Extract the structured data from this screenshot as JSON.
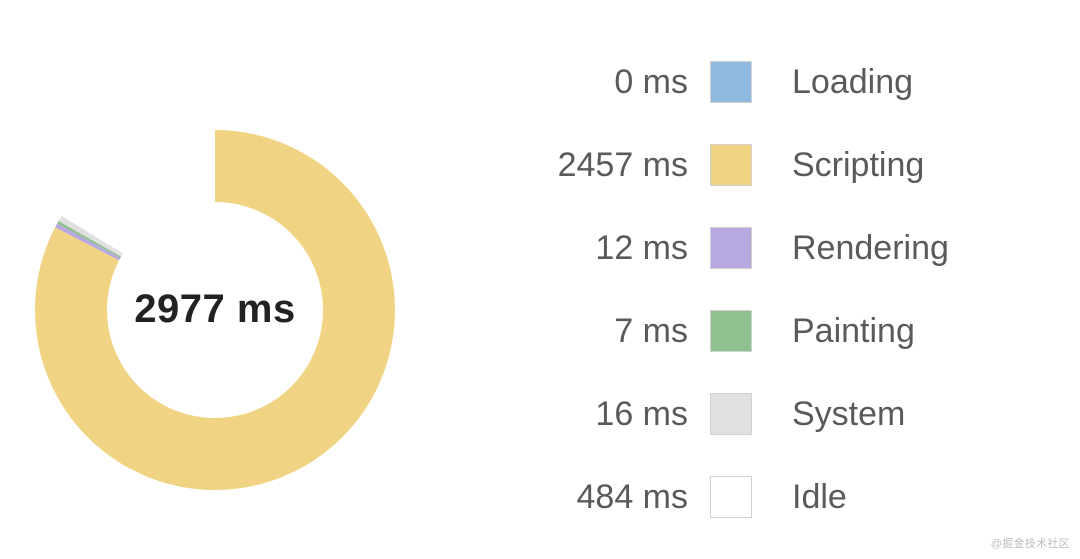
{
  "total_label": "2977 ms",
  "unit": "ms",
  "watermark": "@掘金技术社区",
  "series": [
    {
      "label": "Loading",
      "value": 0,
      "value_label": "0 ms",
      "color": "#8fb9de"
    },
    {
      "label": "Scripting",
      "value": 2457,
      "value_label": "2457 ms",
      "color": "#f0d484"
    },
    {
      "label": "Rendering",
      "value": 12,
      "value_label": "12 ms",
      "color": "#b8a8e0"
    },
    {
      "label": "Painting",
      "value": 7,
      "value_label": "7 ms",
      "color": "#8fc08f"
    },
    {
      "label": "System",
      "value": 16,
      "value_label": "16 ms",
      "color": "#e0e0e0"
    },
    {
      "label": "Idle",
      "value": 484,
      "value_label": "484 ms",
      "color": "#ffffff"
    }
  ],
  "chart_data": {
    "type": "pie",
    "style": "donut",
    "title": "",
    "total": 2977,
    "total_display": "2977 ms",
    "categories": [
      "Loading",
      "Scripting",
      "Rendering",
      "Painting",
      "System",
      "Idle"
    ],
    "values": [
      0,
      2457,
      12,
      7,
      16,
      484
    ],
    "unit": "ms",
    "colors": [
      "#8fb9de",
      "#f0d484",
      "#b8a8e0",
      "#8fc08f",
      "#e0e0e0",
      "#ffffff"
    ]
  }
}
